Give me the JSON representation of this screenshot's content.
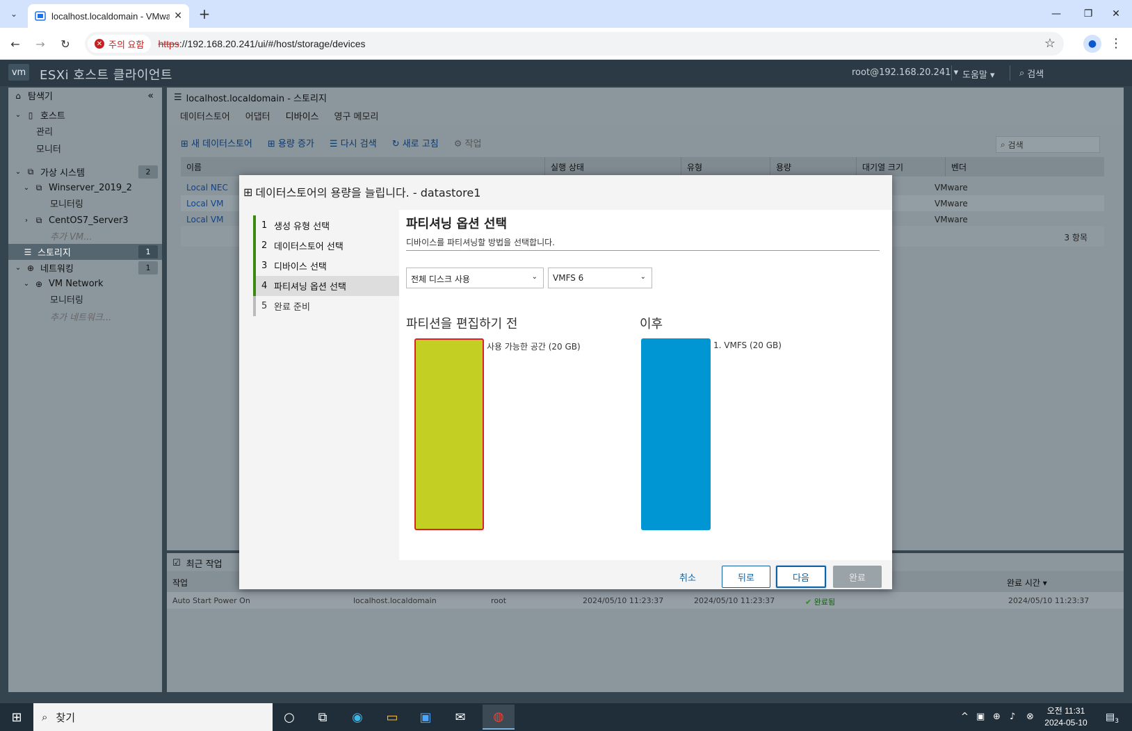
{
  "browser": {
    "tab_title": "localhost.localdomain - VMwa",
    "security_label": "주의 요함",
    "url_scheme": "https",
    "url_rest": "://192.168.20.241/ui/#/host/storage/devices"
  },
  "header": {
    "logo": "vm",
    "app_title": "ESXi 호스트 클라이언트",
    "user": "root@192.168.20.241 ▾",
    "help": "도움말 ▾",
    "search": "검색"
  },
  "navigator": {
    "title": "탐색기",
    "host": "호스트",
    "manage": "관리",
    "monitor": "모니터",
    "vms": "가상 시스템",
    "vms_count": "2",
    "vm1": "Winserver_2019_2",
    "vm1_monitor": "모니터링",
    "vm2": "CentOS7_Server3",
    "more_vms": "추가 VM...",
    "storage": "스토리지",
    "storage_count": "1",
    "networking": "네트워킹",
    "networking_count": "1",
    "vm_network": "VM Network",
    "net_monitor": "모니터링",
    "more_networks": "추가 네트워크..."
  },
  "main": {
    "title": "localhost.localdomain - 스토리지",
    "tabs": [
      "데이터스토어",
      "어댑터",
      "디바이스",
      "영구 메모리"
    ],
    "toolbar": {
      "new_datastore": "새 데이터스토어",
      "increase_capacity": "용량 증가",
      "rescan": "다시 검색",
      "refresh": "새로 고침",
      "actions": "작업",
      "search_placeholder": "검색"
    },
    "columns": [
      "이름",
      "실행 상태",
      "유형",
      "용량",
      "대기열 크기",
      "벤더"
    ],
    "rows": [
      {
        "name": "Local NEC",
        "vendor": "VMware"
      },
      {
        "name": "Local VM",
        "vendor": "VMware"
      },
      {
        "name": "Local VM",
        "vendor": "VMware"
      }
    ],
    "item_count": "3 항목"
  },
  "tasks": {
    "title": "최근 작업",
    "col_task": "작업",
    "col_complete": "완료 시간 ▾",
    "row": {
      "task": "Auto Start Power On",
      "target": "localhost.localdomain",
      "initiator": "root",
      "queued": "2024/05/10 11:23:37",
      "started": "2024/05/10 11:23:37",
      "result": "완료됨",
      "completed": "2024/05/10 11:23:37"
    }
  },
  "wizard": {
    "title": "데이터스토어의 용량을 늘립니다. - datastore1",
    "steps": [
      {
        "num": "1",
        "label": "생성 유형 선택"
      },
      {
        "num": "2",
        "label": "데이터스토어 선택"
      },
      {
        "num": "3",
        "label": "디바이스 선택"
      },
      {
        "num": "4",
        "label": "파티셔닝 옵션 선택"
      },
      {
        "num": "5",
        "label": "완료 준비"
      }
    ],
    "heading": "파티셔닝 옵션 선택",
    "subheading": "디바이스를 파티셔닝할 방법을 선택합니다.",
    "partition_option": "전체 디스크 사용",
    "fs_version": "VMFS 6",
    "before_title": "파티션을 편집하기 전",
    "before_label": "사용 가능한 공간  (20 GB)",
    "after_title": "이후",
    "after_label": "1. VMFS  (20 GB)",
    "colors": {
      "before": "#c3cf22",
      "before_border": "#e02020",
      "after": "#0095d3"
    },
    "buttons": {
      "cancel": "취소",
      "back": "뒤로",
      "next": "다음",
      "finish": "완료"
    }
  },
  "taskbar": {
    "search": "찾기",
    "time": "오전 11:31",
    "date": "2024-05-10",
    "notifications": "3"
  }
}
